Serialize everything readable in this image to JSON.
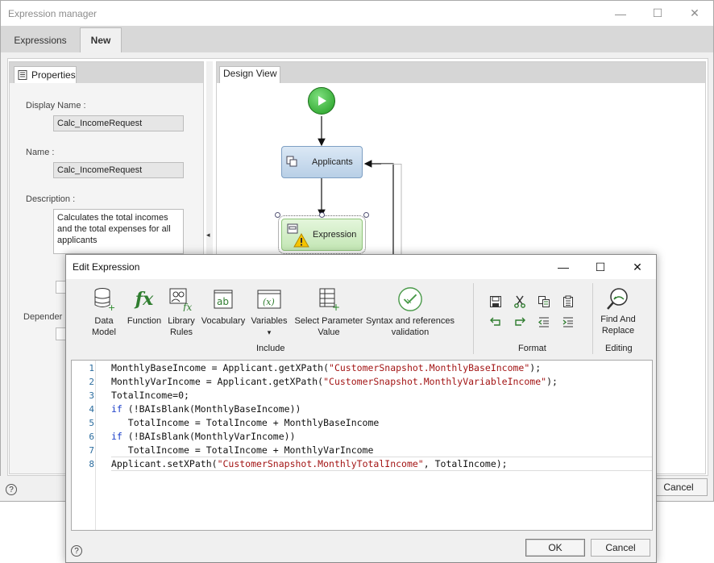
{
  "main_window": {
    "title": "Expression manager",
    "tabs": [
      "Expressions",
      "New"
    ],
    "properties_tab": "Properties",
    "design_tab": "Design View",
    "display_name_label": "Display Name :",
    "display_name_value": "Calc_IncomeRequest",
    "name_label": "Name :",
    "name_value": "Calc_IncomeRequest",
    "description_label": "Description :",
    "description_value": "Calculates the total incomes and the total expenses for all applicants",
    "dependencies_label_partial": "Depender",
    "cancel_button": "Cancel",
    "help_symbol": "?"
  },
  "design_view": {
    "node_applicants": "Applicants",
    "node_expression": "Expression"
  },
  "edit_dialog": {
    "title": "Edit Expression",
    "ribbon": {
      "include_group": "Include",
      "format_group": "Format",
      "editing_group": "Editing",
      "buttons": [
        {
          "label": "Data\nModel",
          "icon": "data-model-icon"
        },
        {
          "label": "Function",
          "icon": "function-icon"
        },
        {
          "label": "Library\nRules",
          "icon": "library-rules-icon"
        },
        {
          "label": "Vocabulary",
          "icon": "vocabulary-icon"
        },
        {
          "label": "Variables",
          "icon": "variables-icon"
        },
        {
          "label": "Select Parameter\nValue",
          "icon": "select-parameter-icon"
        },
        {
          "label": "Syntax and references\nvalidation",
          "icon": "validation-icon"
        },
        {
          "label": "Find And\nReplace",
          "icon": "find-replace-icon"
        }
      ],
      "variables_dropdown_arrow": "▾"
    },
    "code_lines": [
      "MonthlyBaseIncome = Applicant.getXPath(\"CustomerSnapshot.MonthlyBaseIncome\");",
      "MonthlyVarIncome = Applicant.getXPath(\"CustomerSnapshot.MonthlyVariableIncome\");",
      "TotalIncome=0;",
      "if (!BAIsBlank(MonthlyBaseIncome))",
      "   TotalIncome = TotalIncome + MonthlyBaseIncome",
      "if (!BAIsBlank(MonthlyVarIncome))",
      "   TotalIncome = TotalIncome + MonthlyVarIncome",
      "Applicant.setXPath(\"CustomerSnapshot.MonthlyTotalIncome\", TotalIncome);"
    ],
    "line_numbers": [
      "1",
      "2",
      "3",
      "4",
      "5",
      "6",
      "7",
      "8"
    ],
    "ok_button": "OK",
    "cancel_button": "Cancel",
    "help_symbol": "?"
  },
  "colors": {
    "keyword": "#1a3dc8",
    "string": "#a31515",
    "line_number": "#2b6c9e"
  }
}
